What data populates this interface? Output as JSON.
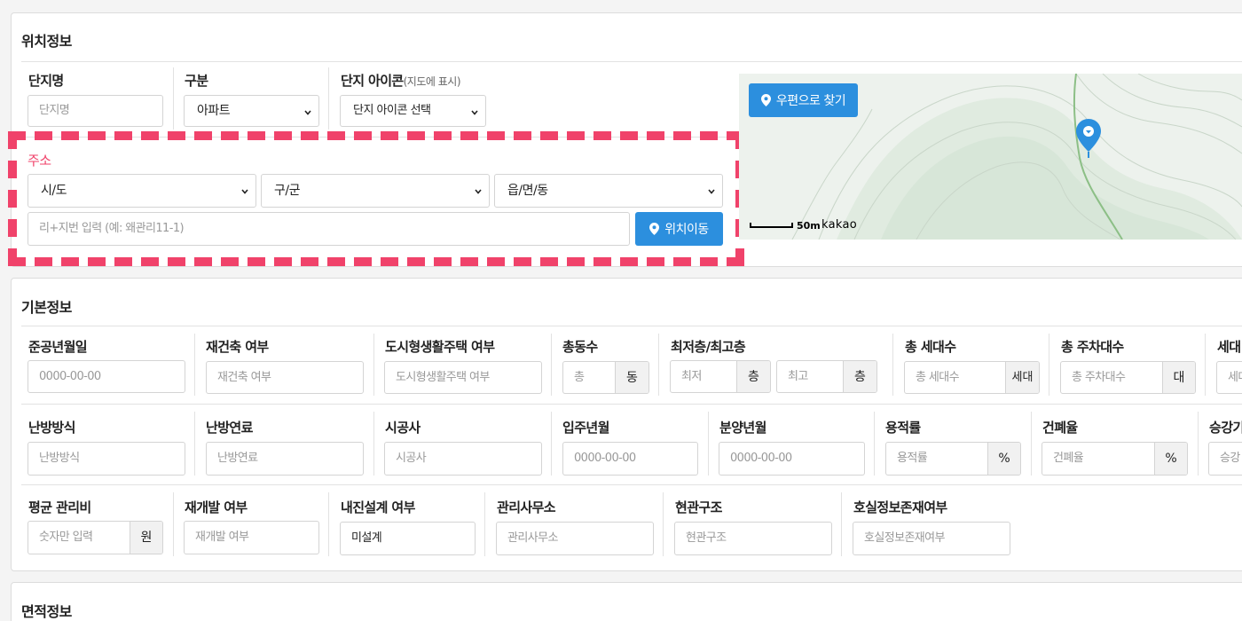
{
  "location": {
    "title": "위치정보",
    "complex_name": {
      "label": "단지명",
      "placeholder": "단지명"
    },
    "category": {
      "label": "구분",
      "value": "아파트"
    },
    "icon": {
      "label": "단지 아이콘",
      "note": "(지도에 표시)",
      "value": "단지 아이콘 선택"
    },
    "address": {
      "label": "주소",
      "sido": "시/도",
      "gugun": "구/군",
      "dong": "읍/면/동",
      "detail_placeholder": "리+지번 입력 (예: 왜관리11-1)",
      "move_button": "위치이동"
    },
    "map": {
      "postcode_button": "우편으로 찾기",
      "scale": "50m",
      "brand": "kakao"
    }
  },
  "basic": {
    "title": "기본정보",
    "row1": {
      "completion": {
        "label": "준공년월일",
        "placeholder": "0000-00-00"
      },
      "rebuild": {
        "label": "재건축 여부",
        "placeholder": "재건축 여부"
      },
      "urban_housing": {
        "label": "도시형생활주택 여부",
        "placeholder": "도시형생활주택 여부"
      },
      "buildings": {
        "label": "총동수",
        "placeholder": "총",
        "unit": "동"
      },
      "floors": {
        "label": "최저층/최고층",
        "min_placeholder": "최저",
        "max_placeholder": "최고",
        "unit": "층"
      },
      "households": {
        "label": "총 세대수",
        "placeholder": "총 세대수",
        "unit": "세대"
      },
      "parking": {
        "label": "총 주차대수",
        "placeholder": "총 주차대수",
        "unit": "대"
      },
      "cut_label": "세대",
      "cut_placeholder": "세대"
    },
    "row2": {
      "heating_method": {
        "label": "난방방식",
        "placeholder": "난방방식"
      },
      "heating_fuel": {
        "label": "난방연료",
        "placeholder": "난방연료"
      },
      "builder": {
        "label": "시공사",
        "placeholder": "시공사"
      },
      "move_in": {
        "label": "입주년월",
        "placeholder": "0000-00-00"
      },
      "sale": {
        "label": "분양년월",
        "placeholder": "0000-00-00"
      },
      "far": {
        "label": "용적률",
        "placeholder": "용적률",
        "unit": "%"
      },
      "bcr": {
        "label": "건폐율",
        "placeholder": "건폐율",
        "unit": "%"
      },
      "cut_label": "승강기",
      "cut_placeholder": "승강"
    },
    "row3": {
      "mgmt_fee": {
        "label": "평균 관리비",
        "placeholder": "숫자만 입력",
        "unit": "원"
      },
      "redevelop": {
        "label": "재개발 여부",
        "placeholder": "재개발 여부"
      },
      "seismic": {
        "label": "내진설계 여부",
        "value": "미설계"
      },
      "office": {
        "label": "관리사무소",
        "placeholder": "관리사무소"
      },
      "entrance": {
        "label": "현관구조",
        "placeholder": "현관구조"
      },
      "room_info": {
        "label": "호실정보존재여부",
        "placeholder": "호실정보존재여부"
      }
    }
  },
  "area": {
    "title": "면적정보"
  },
  "colors": {
    "accent": "#2c8fde",
    "highlight": "#f0426a",
    "address_label": "#f0426a"
  }
}
